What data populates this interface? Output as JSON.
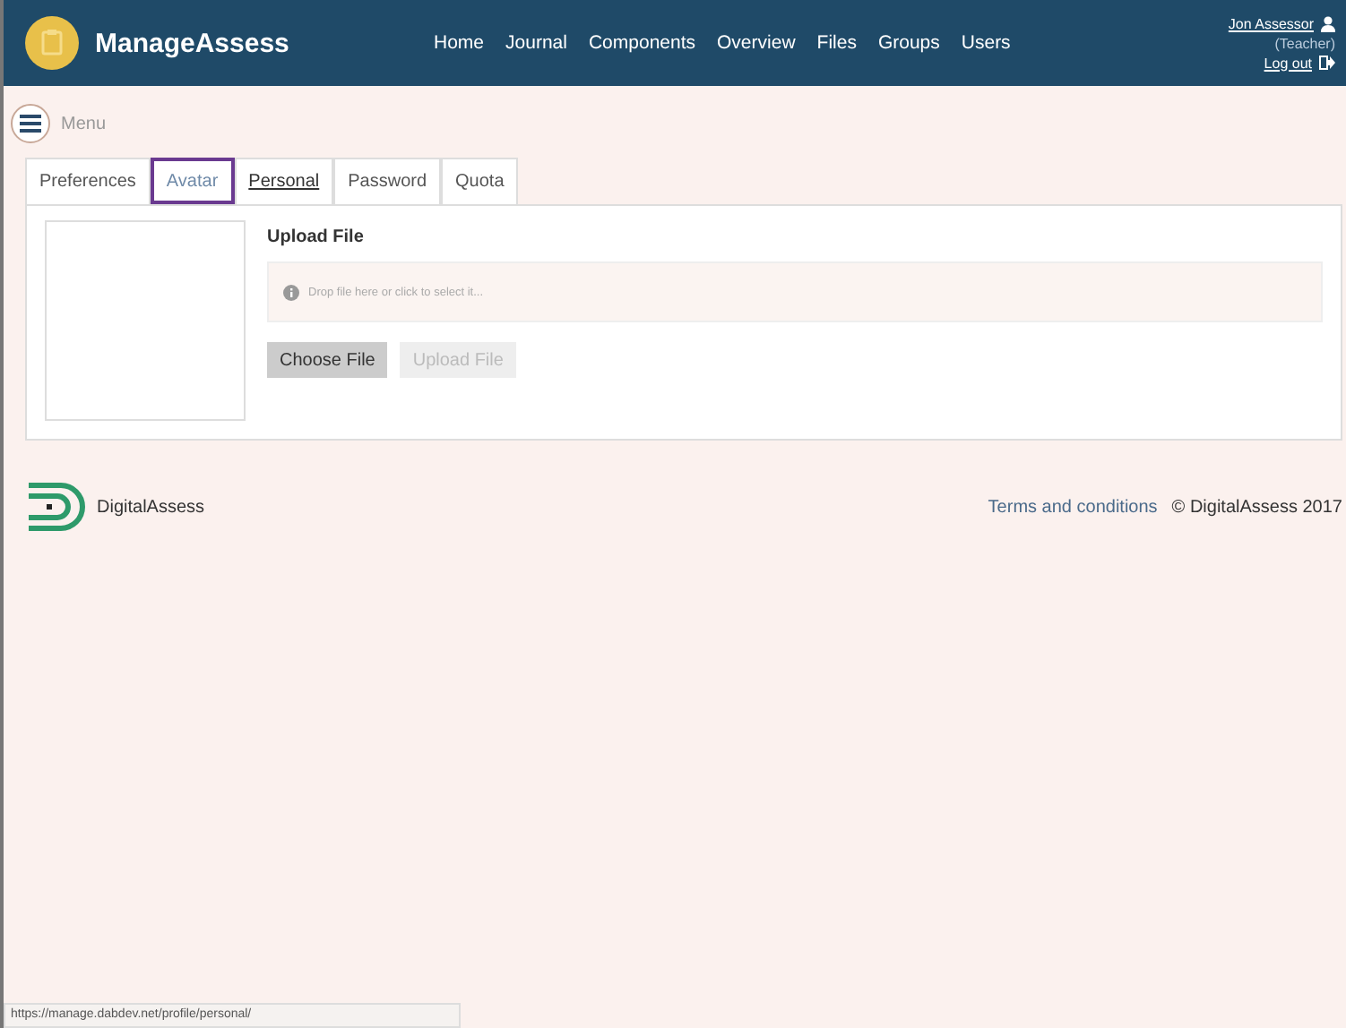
{
  "header": {
    "brand": "ManageAssess",
    "nav": [
      "Home",
      "Journal",
      "Components",
      "Overview",
      "Files",
      "Groups",
      "Users"
    ],
    "user": {
      "name": "Jon Assessor",
      "role": "(Teacher)",
      "logout": "Log out"
    }
  },
  "menu": {
    "label": "Menu"
  },
  "tabs": [
    {
      "label": "Preferences",
      "selected": false,
      "hovered": false
    },
    {
      "label": "Avatar",
      "selected": true,
      "hovered": false
    },
    {
      "label": "Personal",
      "selected": false,
      "hovered": true
    },
    {
      "label": "Password",
      "selected": false,
      "hovered": false
    },
    {
      "label": "Quota",
      "selected": false,
      "hovered": false
    }
  ],
  "upload": {
    "title": "Upload File",
    "placeholder": "Drop file here or click to select it...",
    "buttons": [
      {
        "label": "Choose File",
        "disabled": false
      },
      {
        "label": "Upload File",
        "disabled": true
      }
    ]
  },
  "footer": {
    "brand": "DigitalAssess",
    "links": [
      "Terms and conditions"
    ],
    "copyright": "© DigitalAssess 2017"
  },
  "status_bar": "https://manage.dabdev.net/profile/personal/"
}
